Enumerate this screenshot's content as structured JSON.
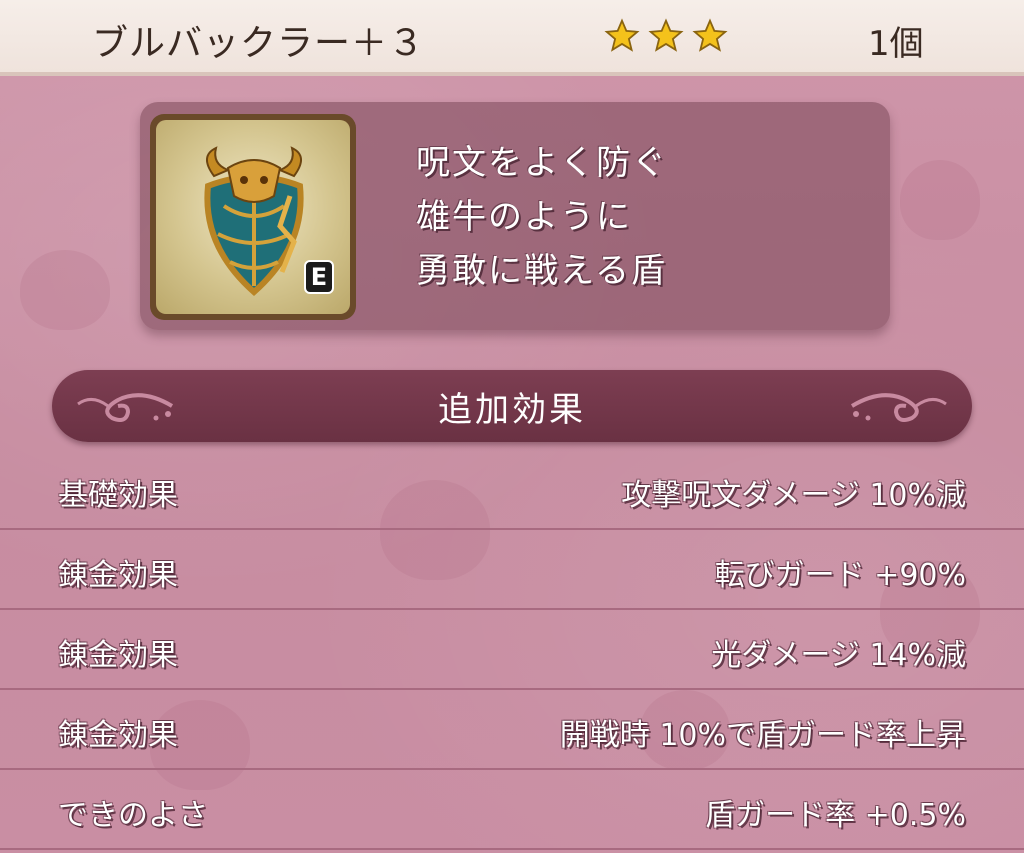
{
  "header": {
    "item_name": "ブルバックラー＋３",
    "rarity_stars": 3,
    "count": "1個"
  },
  "item": {
    "icon": "bull-shield-icon",
    "equipped_badge": "E",
    "description_lines": [
      "呪文をよく防ぐ",
      "雄牛のように",
      "勇敢に戦える盾"
    ]
  },
  "section": {
    "title": "追加効果"
  },
  "effects": [
    {
      "label": "基礎効果",
      "value": "攻撃呪文ダメージ 10%減"
    },
    {
      "label": "錬金効果",
      "value": "転びガード +90%"
    },
    {
      "label": "錬金効果",
      "value": "光ダメージ 14%減"
    },
    {
      "label": "錬金効果",
      "value": "開戦時 10%で盾ガード率上昇"
    },
    {
      "label": "できのよさ",
      "value": "盾ガード率 +0.5%"
    }
  ],
  "colors": {
    "star": "#f4c21b",
    "section_bar": "#6f3447",
    "background": "#c98ea3"
  }
}
